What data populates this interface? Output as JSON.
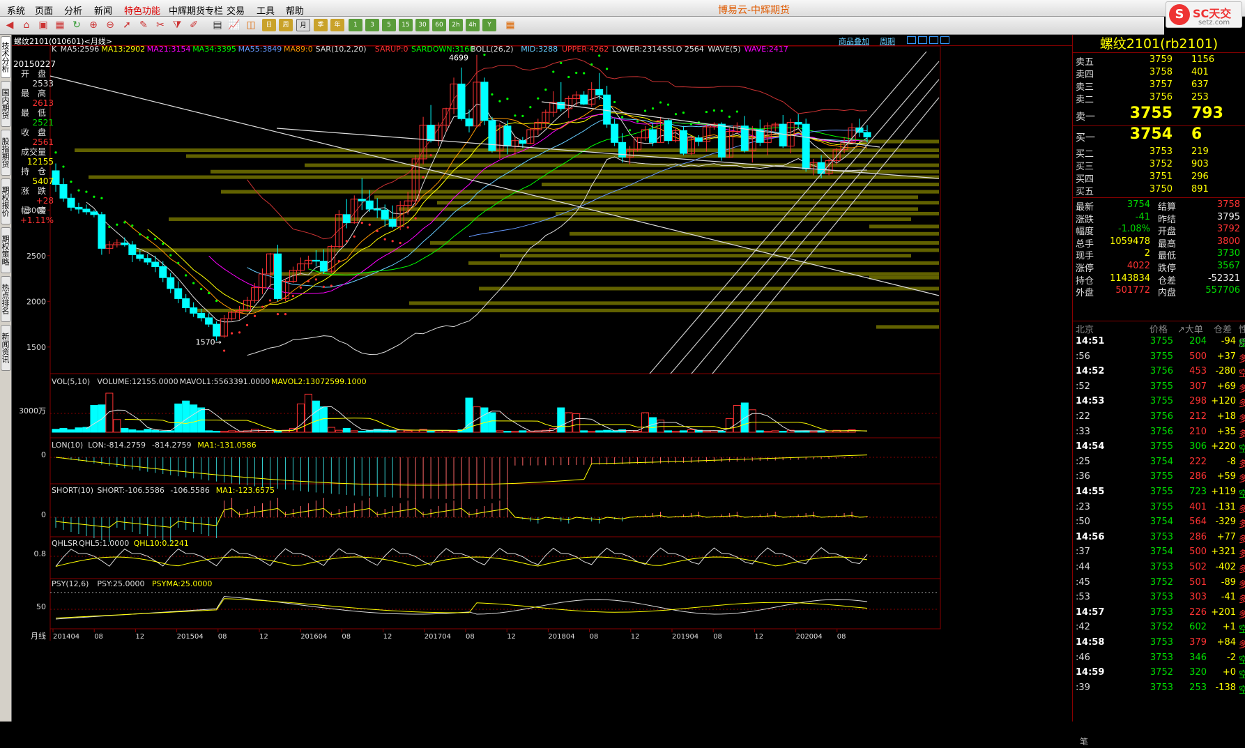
{
  "menu": {
    "items": [
      "系统",
      "页面",
      "分析",
      "新闻",
      "特色功能",
      "中辉期货专栏",
      "交易",
      "工具",
      "帮助"
    ],
    "highlight_index": 4
  },
  "app_title": "博易云-中辉期货",
  "logo": {
    "text": "SC天交",
    "url": "setz.com"
  },
  "toolbar": {
    "period_buttons": [
      "日",
      "周",
      "月",
      "季",
      "年",
      "1",
      "3",
      "5",
      "15",
      "30",
      "60",
      "2h",
      "4h",
      "Y"
    ],
    "selected_period": "月"
  },
  "left_tabs": [
    "技术分析",
    "国内期货",
    "股指期货",
    "期权报价",
    "期权策略",
    "热点排名",
    "新闻资讯"
  ],
  "chart_header": {
    "symbol": "螺纹2101(010601)<月线>",
    "links": [
      "商品叠加",
      "周期"
    ]
  },
  "indicators": {
    "main": [
      [
        "K",
        "#ddd"
      ],
      [
        "MA5:2596",
        "#ddd"
      ],
      [
        "MA13:2902",
        "#ff0"
      ],
      [
        "MA21:3154",
        "#f0f"
      ],
      [
        "MA34:3395",
        "#0f0"
      ],
      [
        "MA55:3849",
        "#69f"
      ],
      [
        "MA89:0",
        "#f90"
      ],
      [
        "SAR(10,2,20)",
        "#ddd"
      ],
      [
        "SARUP:0",
        "#f33"
      ],
      [
        "SARDOWN:3160",
        "#0f0"
      ],
      [
        "BOLL(26,2)",
        "#ddd"
      ],
      [
        "MID:3288",
        "#6cf"
      ],
      [
        "UPPER:4262",
        "#f33"
      ],
      [
        "LOWER:2314",
        "#ddd"
      ],
      [
        "SSLO 2564",
        "#ddd"
      ],
      [
        "WAVE(5)",
        "#ddd"
      ],
      [
        "WAVE:2417",
        "#f0f"
      ]
    ],
    "vol": [
      [
        "VOL(5,10)",
        "#ddd"
      ],
      [
        "VOLUME:12155.0000",
        "#ddd"
      ],
      [
        "MAVOL1:5563391.0000",
        "#ddd"
      ],
      [
        "MAVOL2:13072599.1000",
        "#ff0"
      ]
    ],
    "lon": [
      [
        "LON(10)",
        "#ddd"
      ],
      [
        "LON:-814.2759",
        "#ddd"
      ],
      [
        "-814.2759",
        "#ddd"
      ],
      [
        "MA1:-131.0586",
        "#ff0"
      ]
    ],
    "short": [
      [
        "SHORT(10)",
        "#ddd"
      ],
      [
        "SHORT:-106.5586",
        "#ddd"
      ],
      [
        "-106.5586",
        "#ddd"
      ],
      [
        "MA1:-123.6575",
        "#ff0"
      ]
    ],
    "qhlsr": [
      [
        "QHLSR",
        "#ddd"
      ],
      [
        "QHL5:1.0000",
        "#ddd"
      ],
      [
        "QHL10:0.2241",
        "#ff0"
      ]
    ],
    "psy": [
      [
        "PSY(12,6)",
        "#ddd"
      ],
      [
        "PSY:25.0000",
        "#ddd"
      ],
      [
        "PSYMA:25.0000",
        "#ff0"
      ]
    ]
  },
  "left_info": {
    "date": "20150227",
    "rows": [
      [
        "开　盘",
        "2533",
        "#ddd"
      ],
      [
        "最　高",
        "2613",
        "#f33"
      ],
      [
        "最　低",
        "2521",
        "#0d0"
      ],
      [
        "收　盘",
        "2561",
        "#f33"
      ],
      [
        "成交量",
        "12155",
        "#ff0"
      ],
      [
        "持　仓",
        "5407",
        "#ff0"
      ],
      [
        "涨　跌",
        "+28",
        "#f33"
      ],
      [
        "幅　度",
        "+1.11%",
        "#f33"
      ]
    ]
  },
  "axis": {
    "price_ticks": [
      "3000",
      "2500",
      "2000",
      "1500"
    ],
    "vol_tick": "3000万",
    "lon_tick": "0",
    "short_tick": "0",
    "qhlsr_tick": "0.8",
    "psy_tick": "50",
    "x_label_prefix": "月线",
    "x_labels": [
      "201404",
      "08",
      "12",
      "201504",
      "08",
      "12",
      "201604",
      "08",
      "12",
      "201704",
      "08",
      "12",
      "201804",
      "08",
      "12",
      "201904",
      "08",
      "12",
      "202004",
      "08"
    ]
  },
  "annotations": {
    "high": "4699",
    "low": "1570"
  },
  "quote": {
    "title": "螺纹2101(rb2101)",
    "asks": [
      [
        "卖五",
        "3759",
        "1156"
      ],
      [
        "卖四",
        "3758",
        "401"
      ],
      [
        "卖三",
        "3757",
        "637"
      ],
      [
        "卖二",
        "3756",
        "253"
      ]
    ],
    "ask1": [
      "卖一",
      "3755",
      "793"
    ],
    "bid1": [
      "买一",
      "3754",
      "6"
    ],
    "bids": [
      [
        "买二",
        "3753",
        "219"
      ],
      [
        "买三",
        "3752",
        "903"
      ],
      [
        "买四",
        "3751",
        "296"
      ],
      [
        "买五",
        "3750",
        "891"
      ]
    ],
    "stats": [
      [
        "最新",
        "3754",
        "grn",
        "结算",
        "3758",
        "red"
      ],
      [
        "涨跌",
        "-41",
        "grn",
        "昨结",
        "3795",
        "wht"
      ],
      [
        "幅度",
        "-1.08%",
        "grn",
        "开盘",
        "3792",
        "red"
      ],
      [
        "总手",
        "1059478",
        "yel",
        "最高",
        "3800",
        "red"
      ],
      [
        "现手",
        "2",
        "yel",
        "最低",
        "3730",
        "grn"
      ],
      [
        "涨停",
        "4022",
        "red",
        "跌停",
        "3567",
        "grn"
      ],
      [
        "持仓",
        "1143834",
        "yel",
        "仓差",
        "-52321",
        "wht"
      ],
      [
        "外盘",
        "501772",
        "red",
        "内盘",
        "557706",
        "grn"
      ]
    ],
    "tick_header": [
      "北京",
      "价格",
      "↗大单",
      "仓差",
      "性质"
    ],
    "ticks": [
      [
        "14:51",
        "3755",
        "204",
        "-94",
        "空平",
        "grn"
      ],
      [
        ":56",
        "3755",
        "500",
        "+37",
        "多开",
        "red"
      ],
      [
        "14:52",
        "3756",
        "453",
        "-280",
        "空平",
        "red"
      ],
      [
        ":52",
        "3755",
        "307",
        "+69",
        "多开",
        "red"
      ],
      [
        "14:53",
        "3755",
        "298",
        "+120",
        "多开",
        "red"
      ],
      [
        ":22",
        "3756",
        "212",
        "+18",
        "多开",
        "red"
      ],
      [
        ":33",
        "3756",
        "210",
        "+35",
        "多开",
        "red"
      ],
      [
        "14:54",
        "3755",
        "306",
        "+220",
        "空开",
        "grn"
      ],
      [
        ":25",
        "3754",
        "222",
        "-8",
        "多平",
        "red"
      ],
      [
        ":36",
        "3755",
        "286",
        "+59",
        "多开",
        "red"
      ],
      [
        "14:55",
        "3755",
        "723",
        "+119",
        "空开",
        "grn"
      ],
      [
        ":23",
        "3755",
        "401",
        "-131",
        "多平",
        "red"
      ],
      [
        ":50",
        "3754",
        "564",
        "-329",
        "多平",
        "red"
      ],
      [
        "14:56",
        "3753",
        "286",
        "+77",
        "多开",
        "red"
      ],
      [
        ":37",
        "3754",
        "500",
        "+321",
        "多开",
        "red"
      ],
      [
        ":44",
        "3753",
        "502",
        "-402",
        "多平",
        "red"
      ],
      [
        ":45",
        "3752",
        "501",
        "-89",
        "多平",
        "red"
      ],
      [
        ":53",
        "3753",
        "303",
        "-41",
        "多平",
        "red"
      ],
      [
        "14:57",
        "3753",
        "226",
        "+201",
        "多开",
        "red"
      ],
      [
        ":42",
        "3752",
        "602",
        "+1",
        "空开",
        "grn"
      ],
      [
        "14:58",
        "3753",
        "379",
        "+84",
        "多开",
        "red"
      ],
      [
        ":46",
        "3753",
        "346",
        "-2",
        "空平",
        "grn"
      ],
      [
        "14:59",
        "3752",
        "320",
        "+0",
        "空换",
        "grn"
      ],
      [
        ":39",
        "3753",
        "253",
        "-138",
        "空平",
        "grn"
      ]
    ],
    "bottom_label": "笔"
  },
  "chart_data": {
    "type": "candlestick",
    "axis_price_range": [
      1200,
      4750
    ],
    "candles": [
      [
        3430,
        3510,
        3200,
        3280
      ],
      [
        3280,
        3350,
        3090,
        3130
      ],
      [
        3130,
        3180,
        2990,
        3030
      ],
      [
        3030,
        3080,
        2960,
        3010
      ],
      [
        3010,
        3060,
        2950,
        2980
      ],
      [
        2980,
        3000,
        2920,
        2950
      ],
      [
        2950,
        2980,
        2510,
        2580
      ],
      [
        2580,
        2660,
        2520,
        2620
      ],
      [
        2620,
        2680,
        2590,
        2640
      ],
      [
        2640,
        2700,
        2600,
        2620
      ],
      [
        2620,
        2660,
        2430,
        2510
      ],
      [
        2510,
        2560,
        2440,
        2470
      ],
      [
        2470,
        2520,
        2400,
        2430
      ],
      [
        2430,
        2500,
        2320,
        2380
      ],
      [
        2380,
        2440,
        2210,
        2260
      ],
      [
        2260,
        2310,
        2090,
        2140
      ],
      [
        2140,
        2220,
        1980,
        2030
      ],
      [
        2030,
        2080,
        1880,
        1930
      ],
      [
        1930,
        1990,
        1830,
        1870
      ],
      [
        1870,
        1920,
        1780,
        1820
      ],
      [
        1820,
        1870,
        1720,
        1750
      ],
      [
        1750,
        1780,
        1570,
        1620
      ],
      [
        1620,
        1850,
        1600,
        1810
      ],
      [
        1810,
        1900,
        1790,
        1880
      ],
      [
        1880,
        1950,
        1800,
        1900
      ],
      [
        1900,
        2050,
        1880,
        2010
      ],
      [
        2010,
        2200,
        1980,
        2150
      ],
      [
        2150,
        2360,
        2080,
        2300
      ],
      [
        2300,
        2530,
        2150,
        2520
      ],
      [
        2520,
        2620,
        2000,
        2030
      ],
      [
        2030,
        2250,
        2000,
        2220
      ],
      [
        2220,
        2380,
        2200,
        2340
      ],
      [
        2340,
        2480,
        2290,
        2410
      ],
      [
        2410,
        2500,
        2360,
        2450
      ],
      [
        2450,
        2560,
        2380,
        2440
      ],
      [
        2440,
        2570,
        2300,
        2330
      ],
      [
        2330,
        2620,
        2310,
        2600
      ],
      [
        2600,
        3000,
        2580,
        2950
      ],
      [
        2950,
        3120,
        2800,
        2860
      ],
      [
        2860,
        3160,
        2850,
        3120
      ],
      [
        3120,
        3350,
        3000,
        3100
      ],
      [
        3100,
        3220,
        2980,
        3010
      ],
      [
        3010,
        3130,
        2910,
        3000
      ],
      [
        3000,
        3060,
        2820,
        2900
      ],
      [
        2900,
        3050,
        2800,
        2820
      ],
      [
        2820,
        3100,
        2780,
        3050
      ],
      [
        3050,
        3200,
        2950,
        3100
      ],
      [
        3100,
        3600,
        3050,
        3560
      ],
      [
        3560,
        4020,
        3500,
        3930
      ],
      [
        3930,
        4150,
        3740,
        3760
      ],
      [
        3760,
        3960,
        3700,
        3930
      ],
      [
        3930,
        4120,
        3860,
        4110
      ],
      [
        4110,
        4450,
        4050,
        4380
      ],
      [
        4380,
        4560,
        3980,
        4000
      ],
      [
        4000,
        4100,
        3850,
        3920
      ],
      [
        3920,
        4699,
        3900,
        4400
      ],
      [
        4400,
        4450,
        3930,
        3980
      ],
      [
        3980,
        4020,
        3630,
        3650
      ],
      [
        3650,
        3950,
        3560,
        3920
      ],
      [
        3920,
        3980,
        3610,
        3700
      ],
      [
        3700,
        3800,
        3600,
        3760
      ],
      [
        3760,
        3800,
        3680,
        3730
      ],
      [
        3730,
        3900,
        3720,
        3880
      ],
      [
        3880,
        4000,
        3820,
        3960
      ],
      [
        3960,
        4100,
        3900,
        4070
      ],
      [
        4070,
        4300,
        4020,
        4180
      ],
      [
        4180,
        4400,
        4080,
        4110
      ],
      [
        4110,
        4250,
        4010,
        4220
      ],
      [
        4220,
        4300,
        4140,
        4260
      ],
      [
        4260,
        4300,
        4150,
        4160
      ],
      [
        4160,
        4400,
        4130,
        4320
      ],
      [
        4320,
        4500,
        4210,
        4260
      ],
      [
        4260,
        4360,
        3900,
        3940
      ],
      [
        3940,
        4000,
        3700,
        3740
      ],
      [
        3740,
        3840,
        3520,
        3580
      ],
      [
        3580,
        3700,
        3500,
        3660
      ],
      [
        3660,
        3800,
        3640,
        3790
      ],
      [
        3790,
        3920,
        3760,
        3880
      ],
      [
        3880,
        3950,
        3700,
        3740
      ],
      [
        3740,
        4020,
        3740,
        3980
      ],
      [
        3980,
        4000,
        3720,
        3760
      ],
      [
        3760,
        3900,
        3740,
        3870
      ],
      [
        3870,
        3920,
        3600,
        3620
      ],
      [
        3620,
        3800,
        3600,
        3790
      ],
      [
        3790,
        3820,
        3700,
        3750
      ],
      [
        3750,
        3940,
        3640,
        3910
      ],
      [
        3910,
        3960,
        3880,
        3940
      ],
      [
        3940,
        3960,
        3540,
        3580
      ],
      [
        3580,
        3900,
        3570,
        3860
      ],
      [
        3860,
        3960,
        3840,
        3920
      ],
      [
        3920,
        4030,
        3630,
        3650
      ],
      [
        3650,
        3920,
        3520,
        3880
      ],
      [
        3880,
        3990,
        3700,
        3740
      ],
      [
        3740,
        3960,
        3600,
        3920
      ],
      [
        3920,
        3960,
        3860,
        3940
      ],
      [
        3940,
        4040,
        3680,
        3700
      ],
      [
        3700,
        4000,
        3620,
        3960
      ],
      [
        3960,
        4050,
        3900,
        3940
      ],
      [
        3940,
        4000,
        3420,
        3450
      ],
      [
        3450,
        3560,
        3380,
        3520
      ],
      [
        3520,
        3600,
        3350,
        3400
      ],
      [
        3400,
        3560,
        3380,
        3540
      ],
      [
        3540,
        3680,
        3500,
        3660
      ],
      [
        3660,
        3800,
        3620,
        3740
      ],
      [
        3740,
        3950,
        3720,
        3900
      ],
      [
        3900,
        4000,
        3800,
        3850
      ],
      [
        3850,
        3930,
        3740,
        3800
      ]
    ]
  }
}
